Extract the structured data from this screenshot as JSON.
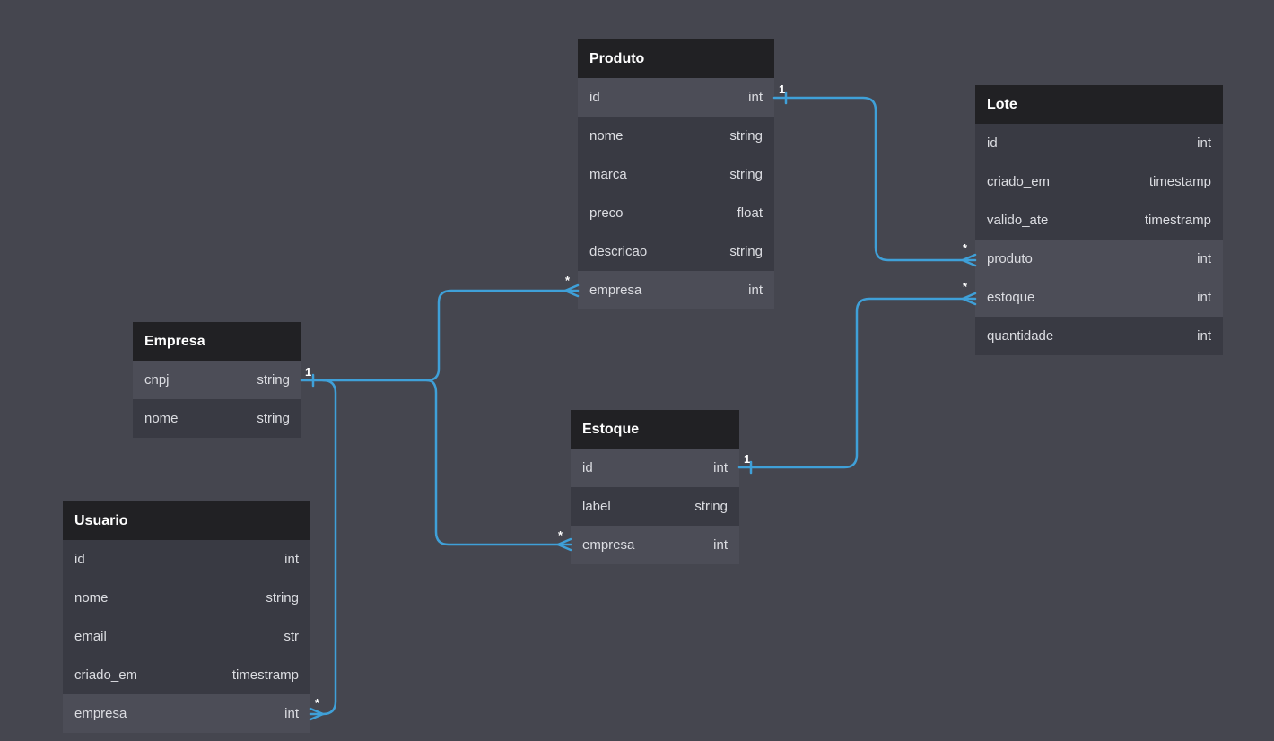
{
  "tables": {
    "produto": {
      "name": "Produto",
      "fields": [
        {
          "name": "id",
          "type": "int"
        },
        {
          "name": "nome",
          "type": "string"
        },
        {
          "name": "marca",
          "type": "string"
        },
        {
          "name": "preco",
          "type": "float"
        },
        {
          "name": "descricao",
          "type": "string"
        },
        {
          "name": "empresa",
          "type": "int"
        }
      ]
    },
    "lote": {
      "name": "Lote",
      "fields": [
        {
          "name": "id",
          "type": "int"
        },
        {
          "name": "criado_em",
          "type": "timestamp"
        },
        {
          "name": "valido_ate",
          "type": "timestramp"
        },
        {
          "name": "produto",
          "type": "int"
        },
        {
          "name": "estoque",
          "type": "int"
        },
        {
          "name": "quantidade",
          "type": "int"
        }
      ]
    },
    "empresa": {
      "name": "Empresa",
      "fields": [
        {
          "name": "cnpj",
          "type": "string"
        },
        {
          "name": "nome",
          "type": "string"
        }
      ]
    },
    "estoque": {
      "name": "Estoque",
      "fields": [
        {
          "name": "id",
          "type": "int"
        },
        {
          "name": "label",
          "type": "string"
        },
        {
          "name": "empresa",
          "type": "int"
        }
      ]
    },
    "usuario": {
      "name": "Usuario",
      "fields": [
        {
          "name": "id",
          "type": "int"
        },
        {
          "name": "nome",
          "type": "string"
        },
        {
          "name": "email",
          "type": "str"
        },
        {
          "name": "criado_em",
          "type": "timestramp"
        },
        {
          "name": "empresa",
          "type": "int"
        }
      ]
    }
  },
  "relations": [
    {
      "from": "produto.id",
      "to": "lote.produto",
      "from_card": "1",
      "to_card": "*"
    },
    {
      "from": "estoque.id",
      "to": "lote.estoque",
      "from_card": "1",
      "to_card": "*"
    },
    {
      "from": "empresa.cnpj",
      "to": "produto.empresa",
      "from_card": "1",
      "to_card": "*"
    },
    {
      "from": "empresa.cnpj",
      "to": "estoque.empresa",
      "from_card": "1",
      "to_card": "*"
    },
    {
      "from": "empresa.cnpj",
      "to": "usuario.empresa",
      "from_card": "1",
      "to_card": "*"
    }
  ],
  "colors": {
    "background": "#45464f",
    "header": "#212124",
    "row": "#393a43",
    "row_highlight": "#4c4d57",
    "link": "#3fa0d8"
  }
}
